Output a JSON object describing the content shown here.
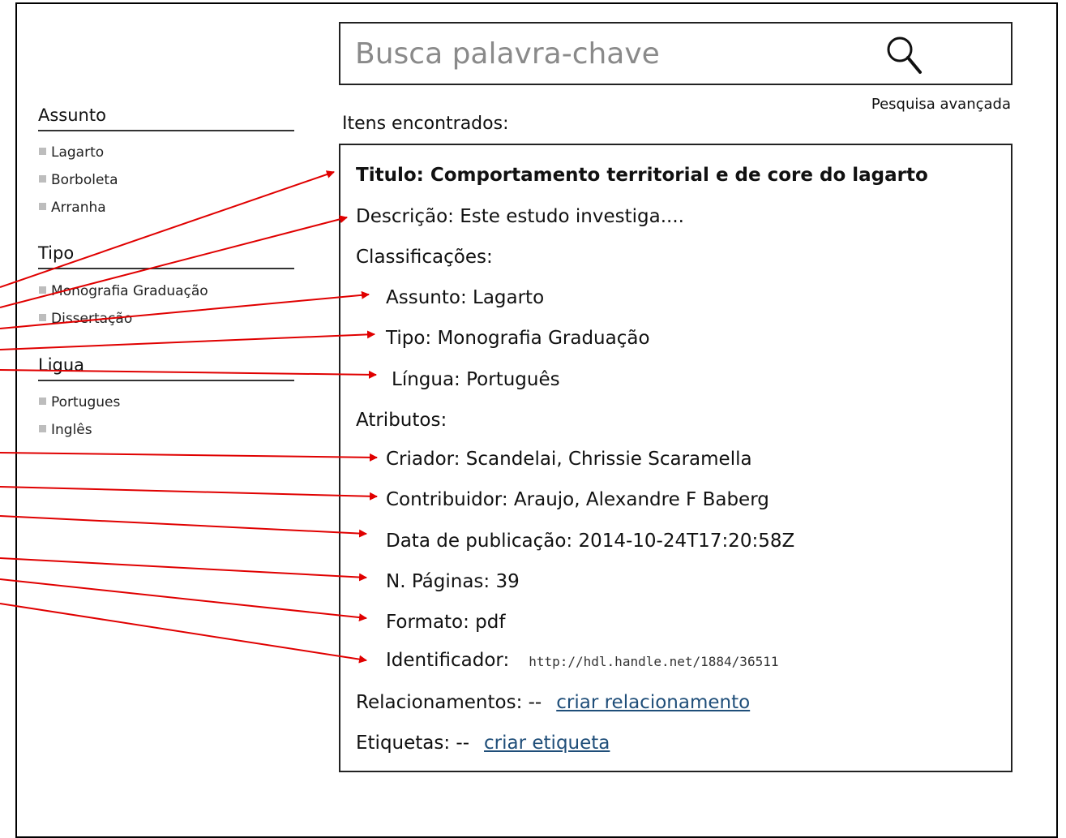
{
  "search": {
    "placeholder": "Busca palavra-chave",
    "advanced_link": "Pesquisa avançada",
    "icon": "search-icon"
  },
  "sidebar": {
    "facets": [
      {
        "title": "Assunto",
        "items": [
          "Lagarto",
          "Borboleta",
          "Arranha"
        ]
      },
      {
        "title": "Tipo",
        "items": [
          "Monografia Graduação",
          "Dissertação"
        ]
      },
      {
        "title": "Ligua",
        "items": [
          "Portugues",
          "Inglês"
        ]
      }
    ]
  },
  "results": {
    "label": "Itens encontrados:",
    "item": {
      "title": "Titulo: Comportamento territorial e de core do lagarto",
      "description": "Descrição: Este estudo investiga....",
      "classifications_label": "Classificações:",
      "subject": "Assunto: Lagarto",
      "type": "Tipo: Monografia Graduação",
      "language": "Língua: Português",
      "attributes_label": "Atributos:",
      "creator": "Criador: Scandelai, Chrissie Scaramella",
      "contributor": "Contribuidor: Araujo, Alexandre F Baberg",
      "pub_date": "Data de publicação:  2014-10-24T17:20:58Z",
      "pages": "N. Páginas: 39",
      "format": "Formato: pdf",
      "identifier_label": "Identificador:",
      "identifier_value": "http://hdl.handle.net/1884/36511",
      "relations_label": "Relacionamentos:   --",
      "relations_link": "criar relacionamento",
      "tags_label": "Etiquetas: --",
      "tags_link": "criar etiqueta"
    }
  },
  "colors": {
    "arrow": "#e00000",
    "link": "#1f4e79",
    "placeholder": "#8a8a8a"
  }
}
